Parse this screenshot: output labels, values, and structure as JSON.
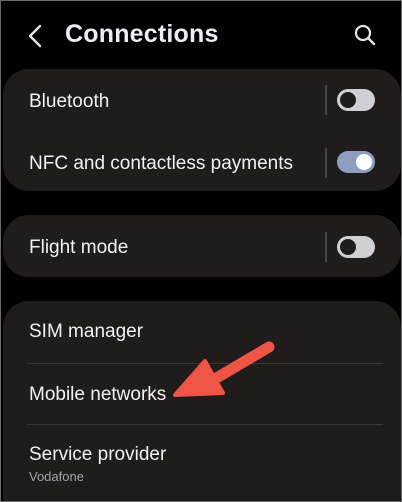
{
  "header": {
    "title": "Connections",
    "back_icon": "chevron-left-icon",
    "search_icon": "search-icon"
  },
  "groups": {
    "group1": {
      "bluetooth": {
        "label": "Bluetooth",
        "enabled": false
      },
      "nfc": {
        "label": "NFC and contactless payments",
        "enabled": true
      }
    },
    "group2": {
      "flight_mode": {
        "label": "Flight mode",
        "enabled": false
      }
    },
    "group3": {
      "sim_manager": {
        "label": "SIM manager"
      },
      "mobile_networks": {
        "label": "Mobile networks"
      },
      "service_provider": {
        "label": "Service provider",
        "sub": "Vodafone"
      }
    }
  },
  "annotation": {
    "type": "arrow-icon",
    "color": "#ee5544",
    "points_to": "Mobile networks"
  },
  "colors": {
    "background": "#000000",
    "card": "#211c1c",
    "toggle_on": "#8e9dc2",
    "toggle_off": "#cfcfd4",
    "text": "#f1f1f3",
    "subtext": "#a4a4aa"
  }
}
